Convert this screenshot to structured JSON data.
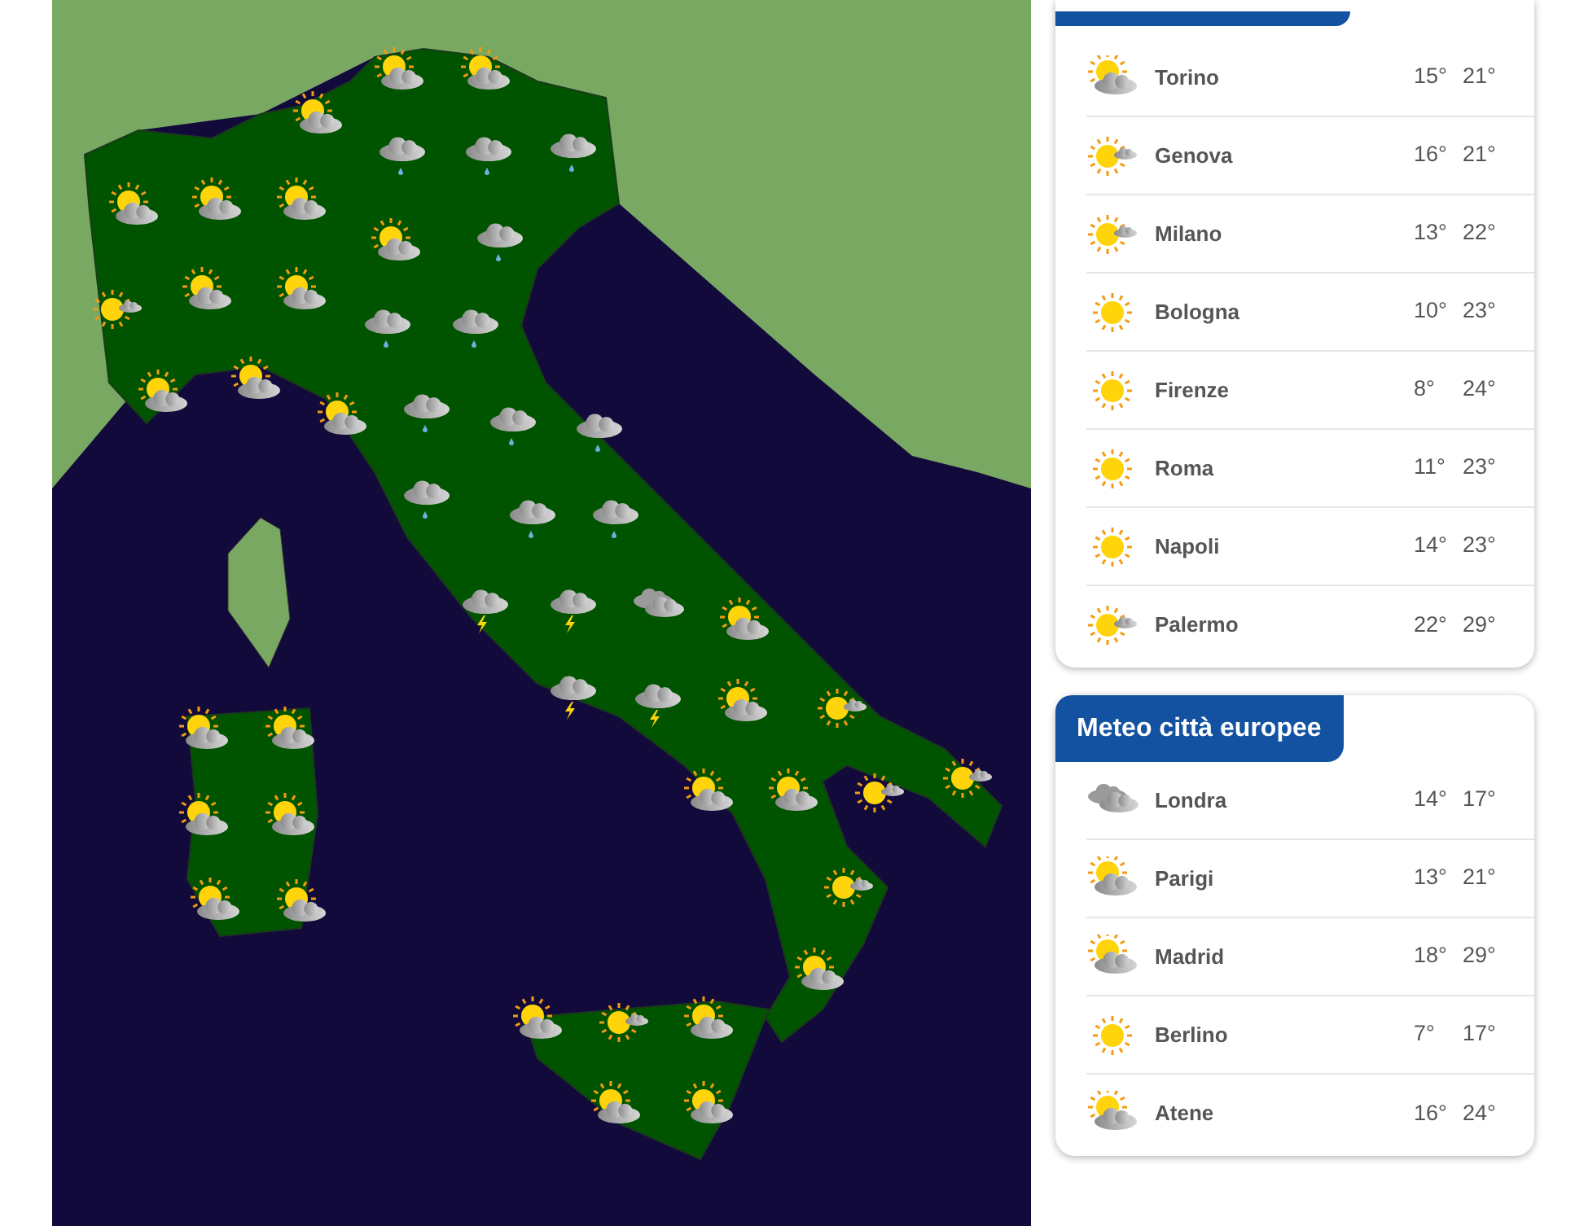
{
  "italy_cities": {
    "rows": [
      {
        "kind": "partly",
        "city": "Torino",
        "min": "15°",
        "max": "21°"
      },
      {
        "kind": "sun_cloud",
        "city": "Genova",
        "min": "16°",
        "max": "21°"
      },
      {
        "kind": "sun_cloud",
        "city": "Milano",
        "min": "13°",
        "max": "22°"
      },
      {
        "kind": "sun",
        "city": "Bologna",
        "min": "10°",
        "max": "23°"
      },
      {
        "kind": "sun",
        "city": "Firenze",
        "min": "8°",
        "max": "24°"
      },
      {
        "kind": "sun",
        "city": "Roma",
        "min": "11°",
        "max": "23°"
      },
      {
        "kind": "sun",
        "city": "Napoli",
        "min": "14°",
        "max": "23°"
      },
      {
        "kind": "sun_cloud",
        "city": "Palermo",
        "min": "22°",
        "max": "29°"
      }
    ]
  },
  "european_cities": {
    "title": "Meteo città europee",
    "rows": [
      {
        "kind": "cloudy",
        "city": "Londra",
        "min": "14°",
        "max": "17°"
      },
      {
        "kind": "partly",
        "city": "Parigi",
        "min": "13°",
        "max": "21°"
      },
      {
        "kind": "partly",
        "city": "Madrid",
        "min": "18°",
        "max": "29°"
      },
      {
        "kind": "sun",
        "city": "Berlino",
        "min": "7°",
        "max": "17°"
      },
      {
        "kind": "partly",
        "city": "Atene",
        "min": "16°",
        "max": "24°"
      }
    ]
  }
}
